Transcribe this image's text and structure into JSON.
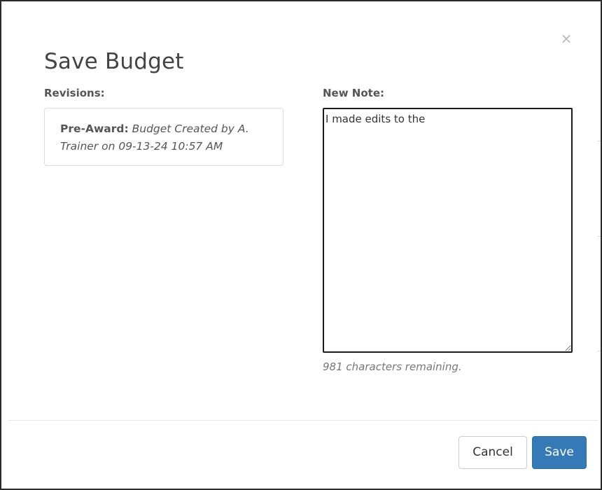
{
  "modal": {
    "title": "Save Budget",
    "close_symbol": "×",
    "close_icon": "close-icon"
  },
  "revisions": {
    "label": "Revisions:",
    "items": [
      {
        "stage": "Pre-Award:",
        "detail": "Budget Created by A. Trainer on 09-13-24 10:57 AM"
      }
    ]
  },
  "new_note": {
    "label": "New Note:",
    "value": "I made edits to the",
    "remaining_text": "981 characters remaining."
  },
  "footer": {
    "cancel_label": "Cancel",
    "save_label": "Save"
  },
  "colors": {
    "primary": "#337ab7",
    "title_text": "#444444",
    "muted_text": "#777777"
  }
}
